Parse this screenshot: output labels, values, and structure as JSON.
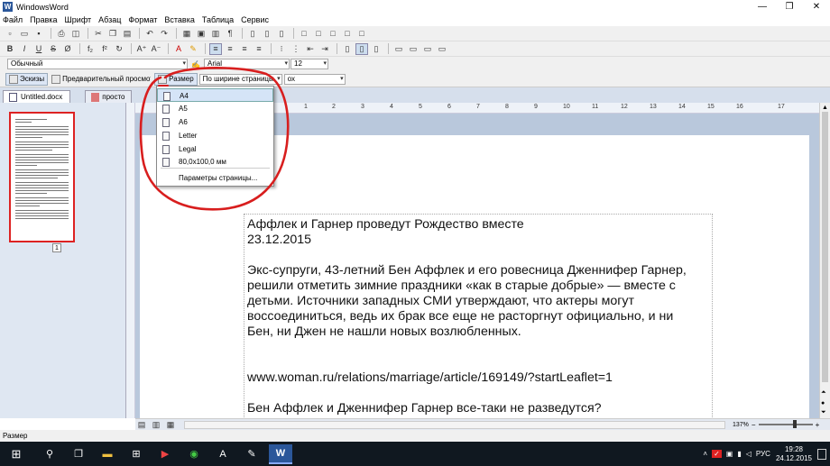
{
  "window": {
    "title": "WindowsWord",
    "controls": [
      "—",
      "❐",
      "✕"
    ]
  },
  "menu": [
    "Файл",
    "Правка",
    "Шрифт",
    "Абзац",
    "Формат",
    "Вставка",
    "Таблица",
    "Сервис"
  ],
  "format_bar": {
    "style": "Обычный",
    "font": "Arial",
    "size": "12"
  },
  "view_bar": {
    "thumbnails_label": "Эскизы",
    "preview_label": "Предварительный просмотр",
    "size_label": "Размер",
    "zoom_mode": "По ширине страницы",
    "extra_combo": "ох"
  },
  "tabs": [
    {
      "label": "Untitled.docx"
    },
    {
      "label": "просто"
    }
  ],
  "thumb_page_number": "1",
  "ruler_numbers": [
    "2",
    "1",
    "1",
    "2",
    "3",
    "4",
    "5",
    "6",
    "7",
    "8",
    "9",
    "10",
    "11",
    "12",
    "13",
    "14",
    "15",
    "16",
    "17"
  ],
  "paper_menu": {
    "items": [
      "A4",
      "A5",
      "A6",
      "Letter",
      "Legal",
      "80,0x100,0 мм"
    ],
    "selected_index": 0,
    "settings_label": "Параметры страницы..."
  },
  "document": {
    "lines": [
      "Аффлек и Гарнер проведут Рождество вместе",
      "23.12.2015",
      "",
      "Экс-супруги, 43-летний Бен Аффлек и его ровесница Дженнифер Гарнер,",
      "решили отметить зимние праздники «как в старые добрые» — вместе с",
      "детьми. Источники западных СМИ утверждают, что актеры могут",
      "воссоединиться, ведь их брак все еще не расторгнут официально, и ни",
      "Бен, ни Джен не нашли новых возлюбленных.",
      "",
      "",
      "www.woman.ru/relations/marriage/article/169149/?startLeaflet=1",
      "",
      "Бен Аффлек и Дженнифер Гарнер все-таки не разведутся?"
    ]
  },
  "zoom": "137%",
  "status_text": "Размер",
  "tray": {
    "lang": "РУС",
    "time": "19:28",
    "date": "24.12.2015"
  },
  "colors": {
    "annotation_red": "#d81e1e",
    "taskbar": "#101820",
    "word_blue": "#2b579a"
  }
}
